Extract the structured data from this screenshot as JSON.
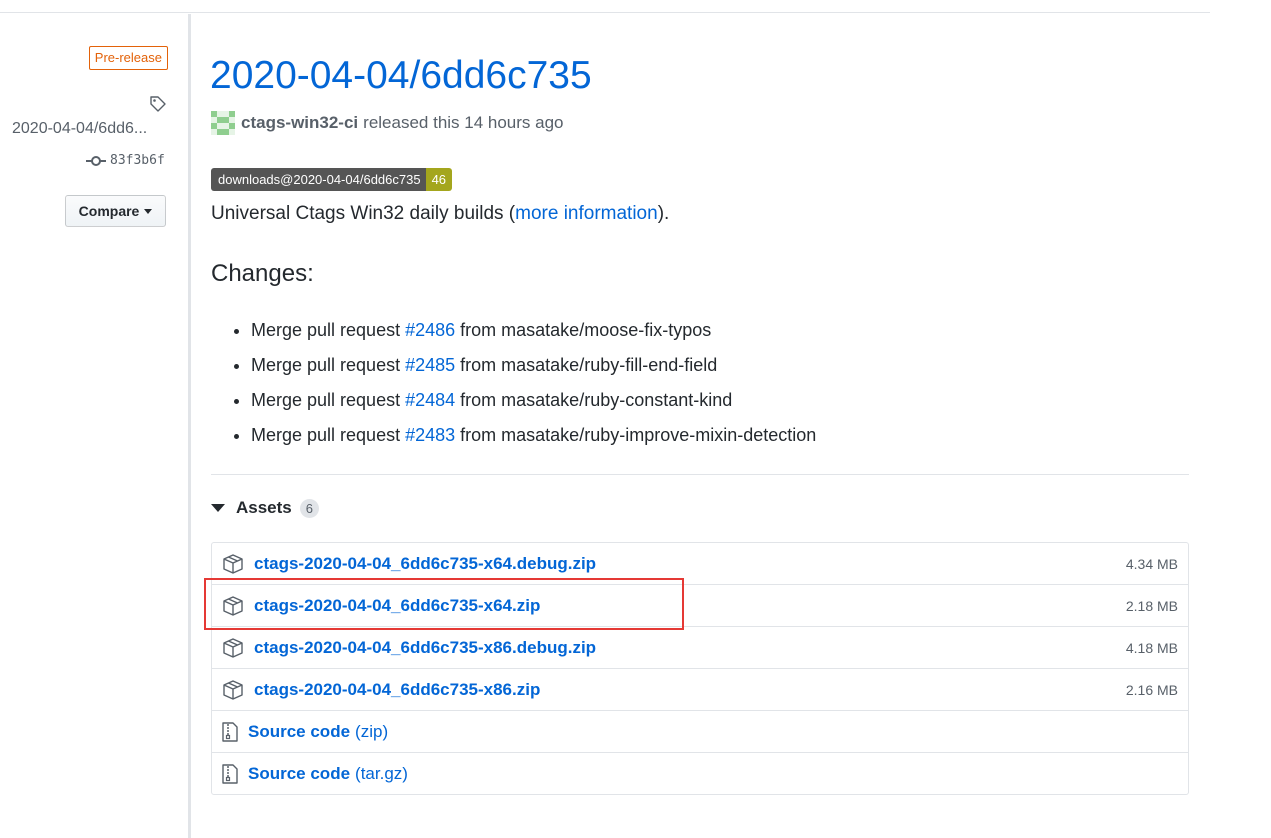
{
  "sidebar": {
    "prerelease_label": "Pre-release",
    "tag_icon": "tag-icon",
    "tag_name": "2020-04-04/6dd6...",
    "commit_icon": "git-commit-icon",
    "commit_sha": "83f3b6f",
    "compare_label": "Compare"
  },
  "release": {
    "title": "2020-04-04/6dd6c735",
    "author": "ctags-win32-ci",
    "released_text": "released this 14 hours ago",
    "badge_label": "downloads@2020-04-04/6dd6c735",
    "badge_count": "46",
    "badge_color": "#a4a61d",
    "description_prefix": "Universal Ctags Win32 daily builds (",
    "description_link": "more information",
    "description_suffix": ")."
  },
  "changes": {
    "heading": "Changes:",
    "items": [
      {
        "prefix": "Merge pull request ",
        "link": "#2486",
        "suffix": " from masatake/moose-fix-typos"
      },
      {
        "prefix": "Merge pull request ",
        "link": "#2485",
        "suffix": " from masatake/ruby-fill-end-field"
      },
      {
        "prefix": "Merge pull request ",
        "link": "#2484",
        "suffix": " from masatake/ruby-constant-kind"
      },
      {
        "prefix": "Merge pull request ",
        "link": "#2483",
        "suffix": " from masatake/ruby-improve-mixin-detection"
      }
    ]
  },
  "assets": {
    "heading": "Assets",
    "count": "6",
    "files": [
      {
        "icon": "package-icon",
        "name": "ctags-2020-04-04_6dd6c735-x64.debug.zip",
        "size": "4.34 MB"
      },
      {
        "icon": "package-icon",
        "name": "ctags-2020-04-04_6dd6c735-x64.zip",
        "size": "2.18 MB"
      },
      {
        "icon": "package-icon",
        "name": "ctags-2020-04-04_6dd6c735-x86.debug.zip",
        "size": "4.18 MB"
      },
      {
        "icon": "package-icon",
        "name": "ctags-2020-04-04_6dd6c735-x86.zip",
        "size": "2.16 MB"
      }
    ],
    "source": [
      {
        "icon": "file-zip-icon",
        "name": "Source code",
        "suffix": "(zip)"
      },
      {
        "icon": "file-zip-icon",
        "name": "Source code",
        "suffix": "(tar.gz)"
      }
    ]
  },
  "colors": {
    "link": "#0366d6",
    "prerelease": "#e36209",
    "highlight": "#e53935"
  }
}
